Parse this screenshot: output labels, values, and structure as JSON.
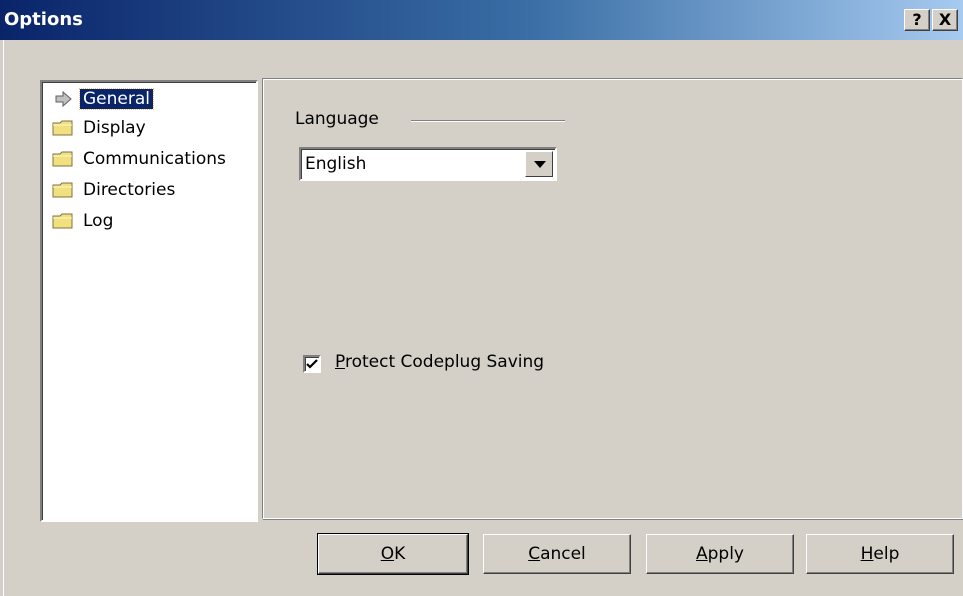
{
  "window": {
    "title": "Options",
    "help_button": "?",
    "close_button": "X"
  },
  "tree": {
    "items": [
      {
        "label": "General",
        "icon": "arrow-icon",
        "selected": true
      },
      {
        "label": "Display",
        "icon": "folder-icon"
      },
      {
        "label": "Communications",
        "icon": "folder-icon"
      },
      {
        "label": "Directories",
        "icon": "folder-icon"
      },
      {
        "label": "Log",
        "icon": "folder-icon"
      }
    ]
  },
  "general": {
    "language_label": "Language",
    "language_value": "English",
    "protect_checkbox": {
      "mnemonic": "P",
      "rest": "rotect Codeplug Saving",
      "checked": true
    }
  },
  "buttons": {
    "ok": {
      "mnemonic": "O",
      "rest": "K"
    },
    "cancel": {
      "mnemonic": "C",
      "rest": "ancel"
    },
    "apply": {
      "mnemonic": "A",
      "rest": "pply"
    },
    "help": {
      "mnemonic": "H",
      "rest": "elp"
    }
  },
  "colors": {
    "face": "#d4d0c8",
    "title_start": "#0a246a",
    "title_end": "#a6caf0",
    "folder": "#f0e080"
  }
}
